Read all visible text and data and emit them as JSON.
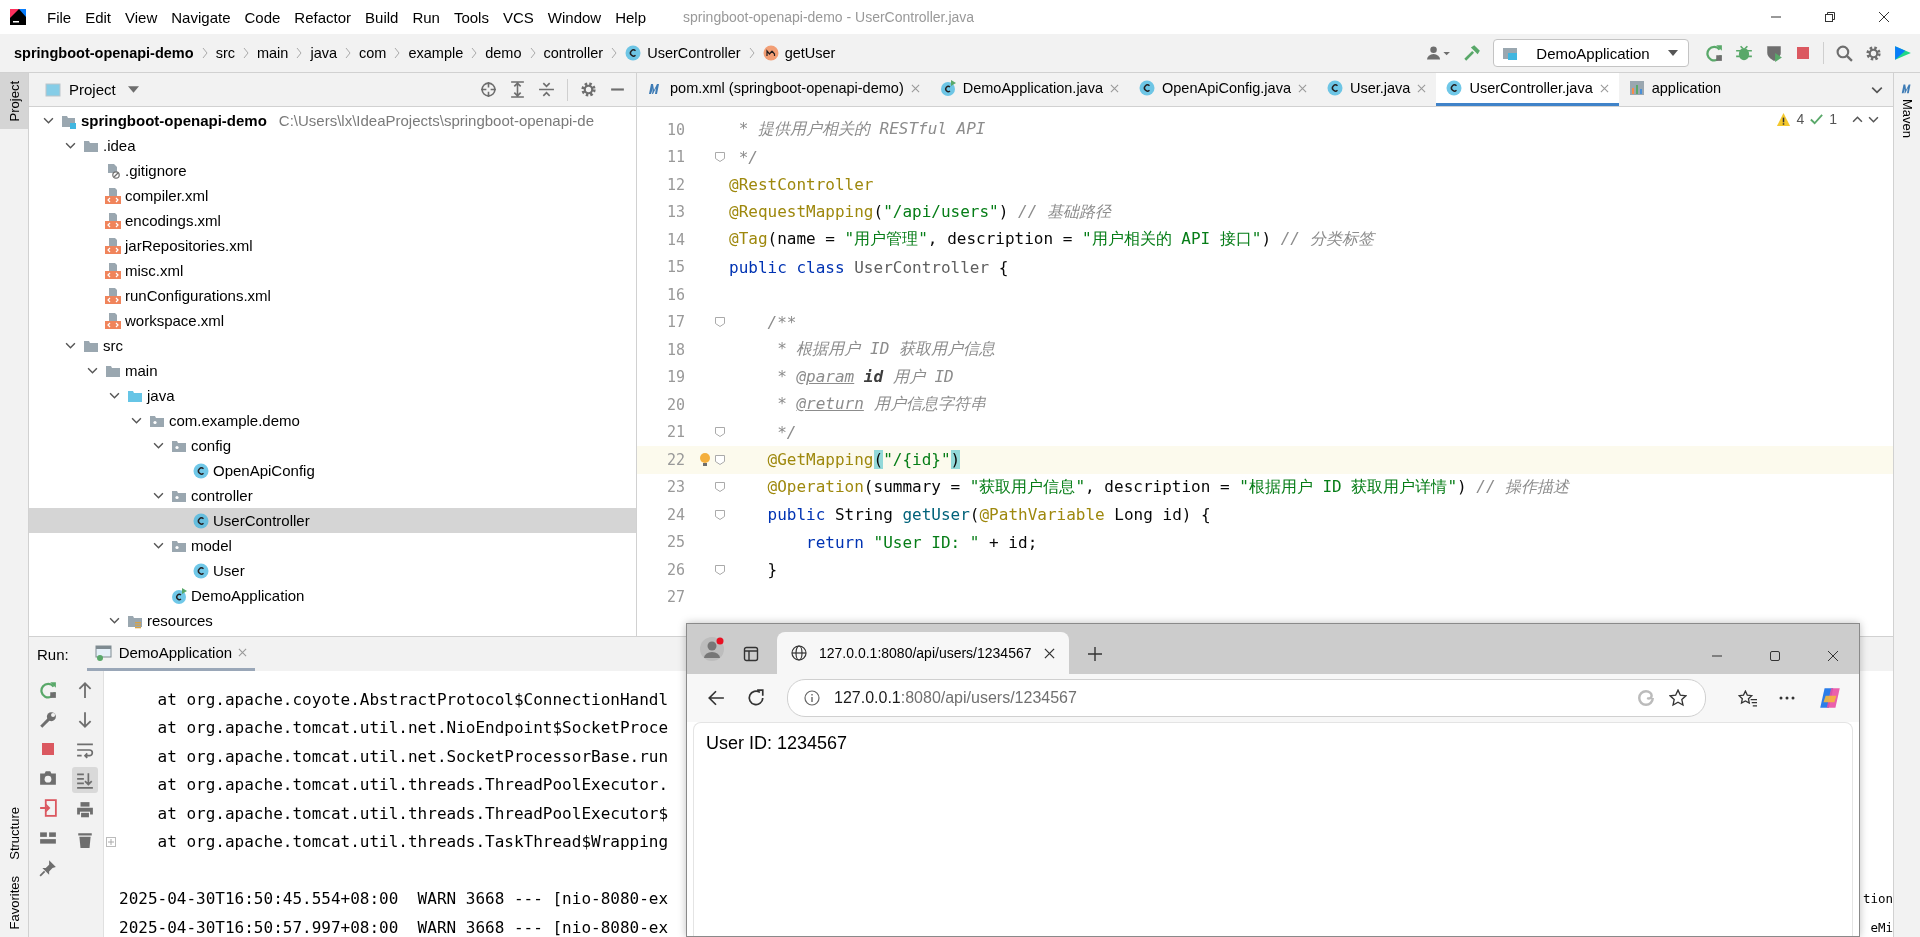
{
  "window": {
    "title": "springboot-openapi-demo - UserController.java"
  },
  "menu": [
    "File",
    "Edit",
    "View",
    "Navigate",
    "Code",
    "Refactor",
    "Build",
    "Run",
    "Tools",
    "VCS",
    "Window",
    "Help"
  ],
  "breadcrumbs": [
    {
      "label": "springboot-openapi-demo",
      "kind": "project"
    },
    {
      "label": "src",
      "kind": "dir"
    },
    {
      "label": "main",
      "kind": "dir"
    },
    {
      "label": "java",
      "kind": "dir"
    },
    {
      "label": "com",
      "kind": "dir"
    },
    {
      "label": "example",
      "kind": "dir"
    },
    {
      "label": "demo",
      "kind": "dir"
    },
    {
      "label": "controller",
      "kind": "dir"
    },
    {
      "label": "UserController",
      "kind": "class"
    },
    {
      "label": "getUser",
      "kind": "method"
    }
  ],
  "toolbar": {
    "run_config": "DemoApplication"
  },
  "left_strip": [
    {
      "label": "Project",
      "selected": true
    },
    {
      "label": "Structure",
      "selected": false
    },
    {
      "label": "Favorites",
      "selected": false
    }
  ],
  "right_strip": [
    {
      "label": "Maven"
    }
  ],
  "project": {
    "title": "Project",
    "tree": [
      {
        "label": "springboot-openapi-demo",
        "path": "C:\\Users\\lx\\IdeaProjects\\springboot-openapi-de",
        "kind": "module",
        "expanded": true,
        "selected": false,
        "children": [
          {
            "label": ".idea",
            "kind": "folder",
            "expanded": true,
            "selected": false,
            "children": [
              {
                "label": ".gitignore",
                "kind": "ignore",
                "selected": false
              },
              {
                "label": "compiler.xml",
                "kind": "xml",
                "selected": false
              },
              {
                "label": "encodings.xml",
                "kind": "xml",
                "selected": false
              },
              {
                "label": "jarRepositories.xml",
                "kind": "xml",
                "selected": false
              },
              {
                "label": "misc.xml",
                "kind": "xml",
                "selected": false
              },
              {
                "label": "runConfigurations.xml",
                "kind": "xml",
                "selected": false
              },
              {
                "label": "workspace.xml",
                "kind": "xml",
                "selected": false
              }
            ]
          },
          {
            "label": "src",
            "kind": "folder",
            "expanded": true,
            "selected": false,
            "children": [
              {
                "label": "main",
                "kind": "folder",
                "expanded": true,
                "selected": false,
                "children": [
                  {
                    "label": "java",
                    "kind": "source",
                    "expanded": true,
                    "selected": false,
                    "children": [
                      {
                        "label": "com.example.demo",
                        "kind": "package",
                        "expanded": true,
                        "selected": false,
                        "children": [
                          {
                            "label": "config",
                            "kind": "package",
                            "expanded": true,
                            "selected": false,
                            "children": [
                              {
                                "label": "OpenApiConfig",
                                "kind": "class",
                                "selected": false
                              }
                            ]
                          },
                          {
                            "label": "controller",
                            "kind": "package",
                            "expanded": true,
                            "selected": false,
                            "children": [
                              {
                                "label": "UserController",
                                "kind": "class",
                                "selected": true
                              }
                            ]
                          },
                          {
                            "label": "model",
                            "kind": "package",
                            "expanded": true,
                            "selected": false,
                            "children": [
                              {
                                "label": "User",
                                "kind": "class",
                                "selected": false
                              }
                            ]
                          },
                          {
                            "label": "DemoApplication",
                            "kind": "app",
                            "selected": false
                          }
                        ]
                      }
                    ]
                  },
                  {
                    "label": "resources",
                    "kind": "resources",
                    "expanded": true,
                    "selected": false
                  }
                ]
              }
            ]
          }
        ]
      }
    ]
  },
  "editor": {
    "tabs": [
      {
        "label": "pom.xml (springboot-openapi-demo)",
        "kind": "maven",
        "selected": false
      },
      {
        "label": "DemoApplication.java",
        "kind": "app",
        "selected": false
      },
      {
        "label": "OpenApiConfig.java",
        "kind": "class",
        "selected": false
      },
      {
        "label": "User.java",
        "kind": "class",
        "selected": false
      },
      {
        "label": "UserController.java",
        "kind": "class",
        "selected": true
      },
      {
        "label": "application",
        "kind": "properties",
        "selected": false
      }
    ],
    "warnings": "4",
    "checks": "1",
    "lines": [
      {
        "number": "10",
        "current": false,
        "fold": false,
        "segments": [
          {
            "kind": "comment",
            "text": " * 提供用户相关的 RESTful API"
          }
        ]
      },
      {
        "number": "11",
        "current": false,
        "fold": true,
        "segments": [
          {
            "kind": "comment",
            "text": " */"
          }
        ]
      },
      {
        "number": "12",
        "current": false,
        "fold": false,
        "segments": [
          {
            "kind": "annotation",
            "text": "@RestController"
          }
        ]
      },
      {
        "number": "13",
        "current": false,
        "fold": false,
        "segments": [
          {
            "kind": "annotation",
            "text": "@RequestMapping"
          },
          {
            "kind": "plain",
            "text": "("
          },
          {
            "kind": "string",
            "text": "\"/api/users\""
          },
          {
            "kind": "plain",
            "text": ") "
          },
          {
            "kind": "comment",
            "text": "// 基础路径"
          }
        ]
      },
      {
        "number": "14",
        "current": false,
        "fold": false,
        "segments": [
          {
            "kind": "annotation",
            "text": "@Tag"
          },
          {
            "kind": "plain",
            "text": "(name = "
          },
          {
            "kind": "string",
            "text": "\"用户管理\""
          },
          {
            "kind": "plain",
            "text": ", description = "
          },
          {
            "kind": "string",
            "text": "\"用户相关的 API 接口\""
          },
          {
            "kind": "plain",
            "text": ") "
          },
          {
            "kind": "comment",
            "text": "// 分类标签"
          }
        ]
      },
      {
        "number": "15",
        "current": false,
        "fold": false,
        "segments": [
          {
            "kind": "keyword",
            "text": "public class "
          },
          {
            "kind": "muted",
            "text": "UserController"
          },
          {
            "kind": "plain",
            "text": " {"
          }
        ]
      },
      {
        "number": "16",
        "current": false,
        "fold": false
      },
      {
        "number": "17",
        "current": false,
        "fold": true,
        "segments": [
          {
            "kind": "comment",
            "text": "    /**"
          }
        ]
      },
      {
        "number": "18",
        "current": false,
        "fold": false,
        "segments": [
          {
            "kind": "comment",
            "text": "     * 根据用户 ID 获取用户信息"
          }
        ]
      },
      {
        "number": "19",
        "current": false,
        "fold": false,
        "segments": [
          {
            "kind": "comment",
            "text": "     * "
          },
          {
            "kind": "doctag",
            "text": "@param"
          },
          {
            "kind": "param",
            "text": " id"
          },
          {
            "kind": "comment",
            "text": " 用户 ID"
          }
        ]
      },
      {
        "number": "20",
        "current": false,
        "fold": false,
        "segments": [
          {
            "kind": "comment",
            "text": "     * "
          },
          {
            "kind": "doctag",
            "text": "@return"
          },
          {
            "kind": "comment",
            "text": " 用户信息字符串"
          }
        ]
      },
      {
        "number": "21",
        "current": false,
        "fold": true,
        "segments": [
          {
            "kind": "comment",
            "text": "     */"
          }
        ]
      },
      {
        "number": "22",
        "current": true,
        "fold": true,
        "segments": [
          {
            "kind": "annotation",
            "text": "    @GetMapping"
          },
          {
            "kind": "match",
            "text": "("
          },
          {
            "kind": "string",
            "text": "\"/{id}\""
          },
          {
            "kind": "match",
            "text": ")"
          }
        ]
      },
      {
        "number": "23",
        "current": false,
        "fold": true,
        "segments": [
          {
            "kind": "annotation",
            "text": "    @Operation"
          },
          {
            "kind": "plain",
            "text": "(summary = "
          },
          {
            "kind": "string",
            "text": "\"获取用户信息\""
          },
          {
            "kind": "plain",
            "text": ", description = "
          },
          {
            "kind": "string",
            "text": "\"根据用户 ID 获取用户详情\""
          },
          {
            "kind": "plain",
            "text": ") "
          },
          {
            "kind": "comment",
            "text": "// 操作描述"
          }
        ]
      },
      {
        "number": "24",
        "current": false,
        "fold": true,
        "segments": [
          {
            "kind": "keyword",
            "text": "    public "
          },
          {
            "kind": "plain",
            "text": "String "
          },
          {
            "kind": "method",
            "text": "getUser"
          },
          {
            "kind": "plain",
            "text": "("
          },
          {
            "kind": "annotation",
            "text": "@PathVariable"
          },
          {
            "kind": "plain",
            "text": " Long id) {"
          }
        ]
      },
      {
        "number": "25",
        "current": false,
        "fold": false,
        "segments": [
          {
            "kind": "keyword",
            "text": "        return "
          },
          {
            "kind": "string",
            "text": "\"User ID: \""
          },
          {
            "kind": "plain",
            "text": " + id;"
          }
        ]
      },
      {
        "number": "26",
        "current": false,
        "fold": true,
        "segments": [
          {
            "kind": "plain",
            "text": "    }"
          }
        ]
      },
      {
        "number": "27",
        "current": false,
        "fold": false
      }
    ]
  },
  "run": {
    "label": "Run:",
    "tabs": [
      {
        "label": "DemoApplication",
        "selected": true
      }
    ],
    "console": [
      {
        "text": "    at org.apache.coyote.AbstractProtocol$ConnectionHandl"
      },
      {
        "text": "    at org.apache.tomcat.util.net.NioEndpoint$SocketProce"
      },
      {
        "text": "    at org.apache.tomcat.util.net.SocketProcessorBase.run"
      },
      {
        "text": "    at org.apache.tomcat.util.threads.ThreadPoolExecutor."
      },
      {
        "text": "    at org.apache.tomcat.util.threads.ThreadPoolExecutor$"
      },
      {
        "text": "    at org.apache.tomcat.util.threads.TaskThread$Wrapping"
      },
      {
        "kind": "blank"
      },
      {
        "text": "2025-04-30T16:50:45.554+08:00  WARN 3668 --- [nio-8080-ex",
        "tail": "tion"
      },
      {
        "text": "2025-04-30T16:50:57.997+08:00  WARN 3668 --- [nio-8080-ex",
        "tail": "eMi"
      }
    ]
  },
  "browser": {
    "tabs": [
      {
        "title": "127.0.0.1:8080/api/users/1234567",
        "selected": true
      }
    ],
    "address_host": "127.0.0.1",
    "address_path": ":8080/api/users/1234567",
    "content": "User ID: 1234567"
  }
}
